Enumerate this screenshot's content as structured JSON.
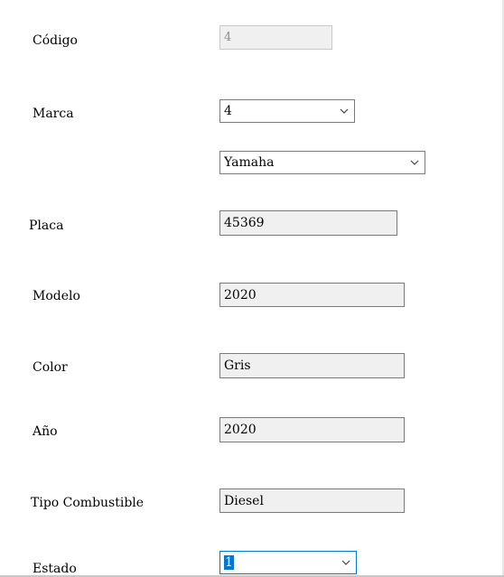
{
  "form": {
    "codigo": {
      "label": "Código",
      "value": "4"
    },
    "marca": {
      "label": "Marca",
      "selected_id": "4",
      "selected_name": "Yamaha"
    },
    "placa": {
      "label": "Placa",
      "value": "45369"
    },
    "modelo": {
      "label": "Modelo",
      "value": "2020"
    },
    "color": {
      "label": "Color",
      "value": "Gris"
    },
    "anio": {
      "label": "Año",
      "value": "2020"
    },
    "tipo_combustible": {
      "label": "Tipo Combustible",
      "value": "Diesel"
    },
    "estado": {
      "label": "Estado",
      "selected": "1"
    }
  },
  "icons": {
    "dropdown": "chevron-down-icon"
  },
  "colors": {
    "focus_accent": "#0078d7",
    "field_background": "#f0f0f0",
    "field_border": "#7a7a7a"
  }
}
